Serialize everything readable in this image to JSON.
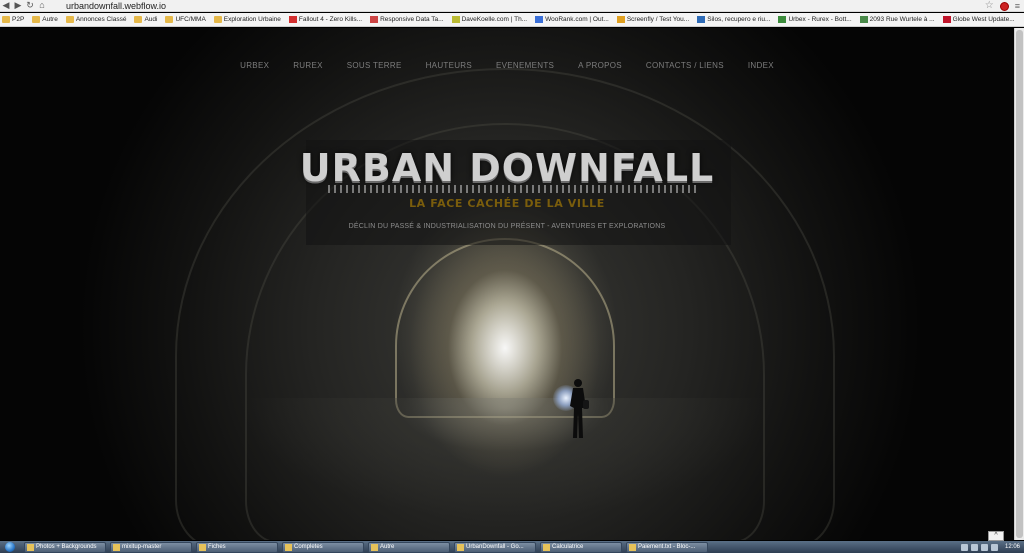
{
  "browser": {
    "url": "urbandownfall.webflow.io",
    "nav_back": "◀",
    "nav_forward": "▶",
    "nav_reload": "↻",
    "nav_home": "⌂",
    "star": "☆",
    "menu": "≡"
  },
  "bookmarks": [
    {
      "label": "P2P",
      "icon": "folder-icon"
    },
    {
      "label": "Autre",
      "icon": "folder-icon"
    },
    {
      "label": "Annonces Classé",
      "icon": "folder-icon"
    },
    {
      "label": "Audi",
      "icon": "folder-icon"
    },
    {
      "label": "UFC/MMA",
      "icon": "folder-icon"
    },
    {
      "label": "Exploration Urbaine",
      "icon": "folder-icon"
    },
    {
      "label": "Fallout 4 - Zero Kills...",
      "icon": "youtube-icon",
      "color": "#d32f2f"
    },
    {
      "label": "Responsive Data Ta...",
      "icon": "site-icon",
      "color": "#c44"
    },
    {
      "label": "DaveKoelle.com | Th...",
      "icon": "site-icon",
      "color": "#bb3"
    },
    {
      "label": "WooRank.com | Out...",
      "icon": "site-icon",
      "color": "#3a6fd8"
    },
    {
      "label": "Screenfly / Test You...",
      "icon": "site-icon",
      "color": "#e0a020"
    },
    {
      "label": "Silos, recupero e riu...",
      "icon": "site-icon",
      "color": "#2e6bb7"
    },
    {
      "label": "Urbex - Rurex - Bott...",
      "icon": "site-icon",
      "color": "#3c8c3c"
    },
    {
      "label": "2093 Rue Wurtele à ...",
      "icon": "maps-icon",
      "color": "#4a8a4a"
    },
    {
      "label": "Globe West Update...",
      "icon": "site-icon",
      "color": "#c0152b"
    }
  ],
  "nav": [
    "URBEX",
    "RUREX",
    "SOUS TERRE",
    "HAUTEURS",
    "EVENEMENTS",
    "A PROPOS",
    "CONTACTS / LIENS",
    "INDEX"
  ],
  "hero": {
    "title": "URBAN DOWNFALL",
    "subtitle": "LA FACE CACHÉE DE LA VILLE",
    "tagline": "DÉCLIN DU PASSÉ & INDUSTRIALISATION DU PRÉSENT - AVENTURES ET EXPLORATIONS"
  },
  "to_top": "^",
  "taskbar": {
    "items": [
      "Photos + Backgrounds",
      "mixitup-master",
      "Fiches",
      "Completes",
      "Autre",
      "UrbanDownfall - Go...",
      "Calculatrice",
      "Paiement.txt - Bloc-..."
    ],
    "clock": "12:06"
  },
  "colors": {
    "subtitle": "#7a5d0c",
    "nav_text": "#7d7d7d",
    "taskbar": "#2e3e52"
  }
}
